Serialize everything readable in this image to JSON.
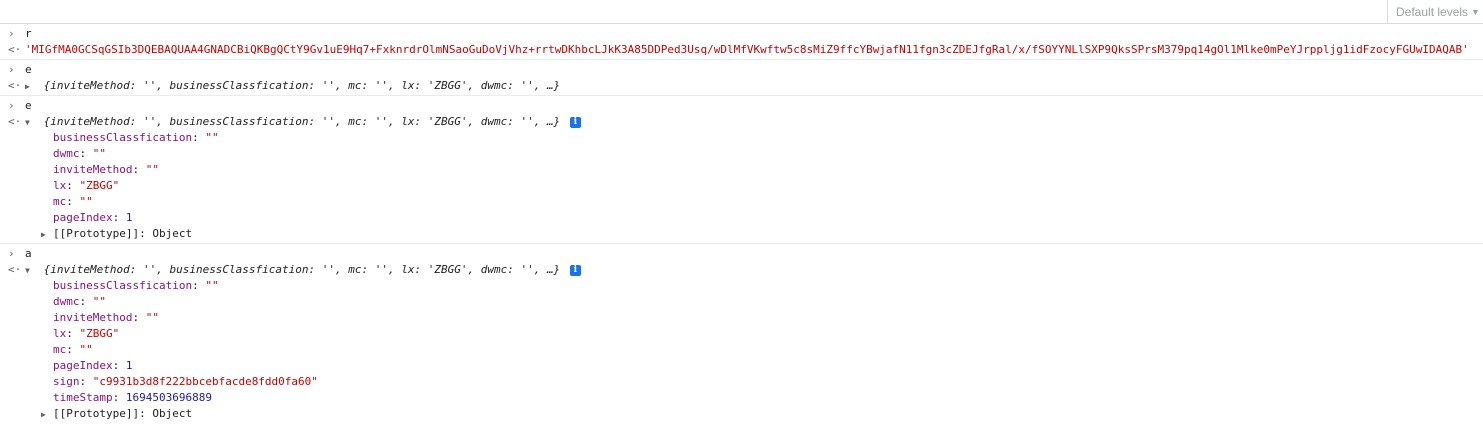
{
  "toolbar": {
    "filter_placeholder": "",
    "levels_label": "Default levels",
    "levels_caret": "▼"
  },
  "glyphs": {
    "input_prompt": "›",
    "result": "<·",
    "collapsed": "▶",
    "expanded": "▼",
    "info": "i"
  },
  "entries": {
    "r": {
      "input": "r",
      "result": "'MIGfMA0GCSqGSIb3DQEBAQUAA4GNADCBiQKBgQCtY9Gv1uE9Hq7+FxknrdrOlmNSaoGuDoVjVhz+rrtwDKhbcLJkK3A85DDPed3Usq/wDlMfVKwftw5c8sMiZ9ffcYBwjafN11fgn3cZDEJfgRal/x/fSOYYNLlSXP9QksSPrsM379pq14gOl1Mlke0mPeYJrpplјg1idFzocyFGUwIDAQAB'"
    },
    "e1": {
      "input": "e",
      "preview": "{inviteMethod: '', businessClassfication: '', mc: '', lx: 'ZBGG', dwmc: '', …}"
    },
    "e2": {
      "input": "e",
      "preview": "{inviteMethod: '', businessClassfication: '', mc: '', lx: 'ZBGG', dwmc: '', …}",
      "props": [
        {
          "key": "businessClassfication",
          "sep": ": ",
          "value": "\"\""
        },
        {
          "key": "dwmc",
          "sep": ": ",
          "value": "\"\""
        },
        {
          "key": "inviteMethod",
          "sep": ": ",
          "value": "\"\""
        },
        {
          "key": "lx",
          "sep": ": ",
          "value": "\"ZBGG\""
        },
        {
          "key": "mc",
          "sep": ": ",
          "value": "\"\""
        },
        {
          "key": "pageIndex",
          "sep": ": ",
          "value": "1"
        }
      ],
      "prototype": {
        "key": "[[Prototype]]",
        "sep": ": ",
        "value": "Object"
      }
    },
    "a": {
      "input": "a",
      "preview": "{inviteMethod: '', businessClassfication: '', mc: '', lx: 'ZBGG', dwmc: '', …}",
      "props": [
        {
          "key": "businessClassfication",
          "sep": ": ",
          "value": "\"\""
        },
        {
          "key": "dwmc",
          "sep": ": ",
          "value": "\"\""
        },
        {
          "key": "inviteMethod",
          "sep": ": ",
          "value": "\"\""
        },
        {
          "key": "lx",
          "sep": ": ",
          "value": "\"ZBGG\""
        },
        {
          "key": "mc",
          "sep": ": ",
          "value": "\"\""
        },
        {
          "key": "pageIndex",
          "sep": ": ",
          "value": "1"
        },
        {
          "key": "sign",
          "sep": ": ",
          "value": "\"c9931b3d8f222bbcebfacde8fdd0fa60\""
        },
        {
          "key": "timeStamp",
          "sep": ": ",
          "value": "1694503696889"
        }
      ],
      "prototype": {
        "key": "[[Prototype]]",
        "sep": ": ",
        "value": "Object"
      }
    }
  },
  "colors": {
    "string": "#c80000",
    "key": "#881280",
    "number": "#1a1aa6",
    "info_badge": "#1a73e8",
    "separator": "#ebebeb"
  }
}
